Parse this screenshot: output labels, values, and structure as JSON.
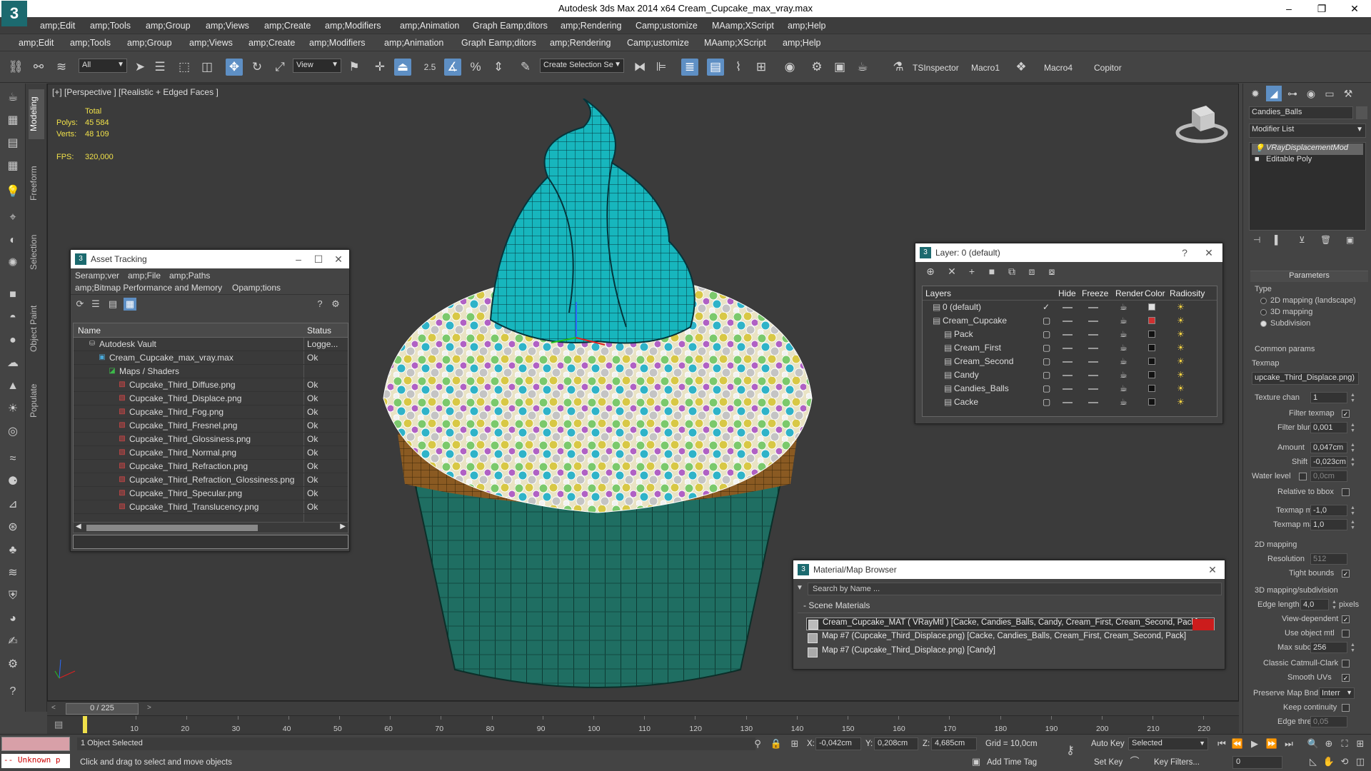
{
  "app": {
    "title": "Autodesk 3ds Max  2014 x64     Cream_Cupcake_max_vray.max"
  },
  "menu_primary": [
    "amp;Edit",
    "amp;Tools",
    "amp;Group",
    "amp;Views",
    "amp;Create",
    "amp;Modifiers",
    "amp;Animation",
    "Graph Eamp;ditors",
    "amp;Rendering",
    "Camp;ustomize",
    "MAamp;XScript",
    "amp;Help"
  ],
  "menu_secondary": [
    "amp;Edit",
    "amp;Tools",
    "amp;Group",
    "amp;Views",
    "amp;Create",
    "amp;Modifiers",
    "amp;Animation",
    "Graph Eamp;ditors",
    "amp;Rendering",
    "Camp;ustomize",
    "MAamp;XScript",
    "amp;Help"
  ],
  "toolbar": {
    "filter_value": "All",
    "refcoord_value": "View",
    "snap_angle": "2.5",
    "selection_set_placeholder": "Create Selection Se",
    "scripts": [
      "TSInspector",
      "Macro1",
      "Macro4",
      "Copitor"
    ]
  },
  "ribbon_tabs": [
    "Modeling",
    "Freeform",
    "Selection",
    "Object Paint",
    "Populate"
  ],
  "viewport": {
    "label": "[+] [Perspective ] [Realistic + Edged Faces ]",
    "stats": {
      "total_label": "Total",
      "polys_label": "Polys:",
      "polys_value": "45 584",
      "verts_label": "Verts:",
      "verts_value": "48 109",
      "fps_label": "FPS:",
      "fps_value": "320,000"
    },
    "colors": {
      "frosting": "#17b6bd",
      "cake": "#8a5a22",
      "wrapper": "#1f6e62"
    }
  },
  "asset_tracking": {
    "title": "Asset Tracking",
    "menus": [
      "Seramp;ver",
      "amp;File",
      "amp;Paths",
      "amp;Bitmap Performance and Memory",
      "Opamp;tions"
    ],
    "columns": {
      "name": "Name",
      "status": "Status"
    },
    "rows": [
      {
        "name": "Autodesk Vault",
        "status": "Logge...",
        "indent": 1,
        "icon": "vault-icon"
      },
      {
        "name": "Cream_Cupcake_max_vray.max",
        "status": "Ok",
        "indent": 2,
        "icon": "max-file-icon"
      },
      {
        "name": "Maps / Shaders",
        "status": "",
        "indent": 3,
        "icon": "maps-icon"
      },
      {
        "name": "Cupcake_Third_Diffuse.png",
        "status": "Ok",
        "indent": 4,
        "icon": "image-icon"
      },
      {
        "name": "Cupcake_Third_Displace.png",
        "status": "Ok",
        "indent": 4,
        "icon": "image-icon"
      },
      {
        "name": "Cupcake_Third_Fog.png",
        "status": "Ok",
        "indent": 4,
        "icon": "image-icon"
      },
      {
        "name": "Cupcake_Third_Fresnel.png",
        "status": "Ok",
        "indent": 4,
        "icon": "image-icon"
      },
      {
        "name": "Cupcake_Third_Glossiness.png",
        "status": "Ok",
        "indent": 4,
        "icon": "image-icon"
      },
      {
        "name": "Cupcake_Third_Normal.png",
        "status": "Ok",
        "indent": 4,
        "icon": "image-icon"
      },
      {
        "name": "Cupcake_Third_Refraction.png",
        "status": "Ok",
        "indent": 4,
        "icon": "image-icon"
      },
      {
        "name": "Cupcake_Third_Refraction_Glossiness.png",
        "status": "Ok",
        "indent": 4,
        "icon": "image-icon"
      },
      {
        "name": "Cupcake_Third_Specular.png",
        "status": "Ok",
        "indent": 4,
        "icon": "image-icon"
      },
      {
        "name": "Cupcake_Third_Translucency.png",
        "status": "Ok",
        "indent": 4,
        "icon": "image-icon"
      }
    ]
  },
  "layer_window": {
    "title": "Layer: 0 (default)",
    "help": "?",
    "columns": [
      "Layers",
      "Hide",
      "Freeze",
      "Render",
      "Color",
      "Radiosity"
    ],
    "rows": [
      {
        "name": "0 (default)",
        "indent": 1,
        "current": true,
        "color": "#e0e0e0"
      },
      {
        "name": "Cream_Cupcake",
        "indent": 1,
        "current": false,
        "color": "#d03030"
      },
      {
        "name": "Pack",
        "indent": 2,
        "current": false,
        "color": "#111111"
      },
      {
        "name": "Cream_First",
        "indent": 2,
        "current": false,
        "color": "#111111"
      },
      {
        "name": "Cream_Second",
        "indent": 2,
        "current": false,
        "color": "#111111"
      },
      {
        "name": "Candy",
        "indent": 2,
        "current": false,
        "color": "#111111"
      },
      {
        "name": "Candies_Balls",
        "indent": 2,
        "current": false,
        "color": "#111111"
      },
      {
        "name": "Cacke",
        "indent": 2,
        "current": false,
        "color": "#111111"
      }
    ]
  },
  "material_browser": {
    "title": "Material/Map Browser",
    "search_placeholder": "Search by Name ...",
    "section": "- Scene Materials",
    "items": [
      "Cream_Cupcake_MAT  ( VRayMtl ) [Cacke, Candies_Balls, Candy, Cream_First, Cream_Second, Pack]",
      "Map #7 (Cupcake_Third_Displace.png) [Cacke, Candies_Balls, Cream_First, Cream_Second, Pack]",
      "Map #7 (Cupcake_Third_Displace.png) [Candy]"
    ]
  },
  "command_panel": {
    "object_name": "Candies_Balls",
    "modifier_list": "Modifier List",
    "stack": [
      "VRayDisplacementMod",
      "Editable Poly"
    ],
    "rollout_title": "Parameters",
    "type_label": "Type",
    "type_options": [
      "2D mapping (landscape)",
      "3D mapping",
      "Subdivision"
    ],
    "type_selected": 2,
    "common_params": "Common params",
    "texmap_label": "Texmap",
    "texmap_value": "upcake_Third_Displace.png)",
    "texture_chan_label": "Texture chan",
    "texture_chan_value": "1",
    "filter_texmap_label": "Filter texmap",
    "filter_blur_label": "Filter blur",
    "filter_blur_value": "0,001",
    "amount_label": "Amount",
    "amount_value": "0,047cm",
    "shift_label": "Shift",
    "shift_value": "-0,023cm",
    "water_level_label": "Water level",
    "water_level_value": "0,0cm",
    "relative_bbox_label": "Relative to bbox",
    "texmap_min_label": "Texmap min",
    "texmap_min_value": "-1,0",
    "texmap_max_label": "Texmap max",
    "texmap_max_value": "1,0",
    "mapping2d_label": "2D mapping",
    "resolution_label": "Resolution",
    "resolution_value": "512",
    "tight_bounds_label": "Tight bounds",
    "mapping3d_label": "3D mapping/subdivision",
    "edge_length_label": "Edge length",
    "edge_length_value": "4,0",
    "pixels_label": "pixels",
    "view_dependent_label": "View-dependent",
    "use_object_mtl_label": "Use object mtl",
    "max_subdivs_label": "Max subdivs",
    "max_subdivs_value": "256",
    "classic_cc_label": "Classic Catmull-Clark",
    "smooth_uvs_label": "Smooth UVs",
    "preserve_map_label": "Preserve Map Bnd",
    "preserve_map_value": "Interr",
    "keep_continuity_label": "Keep continuity",
    "edge_thresh_label": "Edge thresh",
    "edge_thresh_value": "0,05"
  },
  "timeline": {
    "slider_text": "0 / 225",
    "ticks": [
      10,
      20,
      30,
      40,
      50,
      60,
      70,
      80,
      90,
      100,
      110,
      120,
      130,
      140,
      150,
      160,
      170,
      180,
      190,
      200,
      210,
      220
    ]
  },
  "status": {
    "maxscript": "-- Unknown p",
    "selected": "1 Object Selected",
    "prompt": "Click and drag to select and move objects",
    "x_label": "X:",
    "x_value": "-0,042cm",
    "y_label": "Y:",
    "y_value": "0,208cm",
    "z_label": "Z:",
    "z_value": "4,685cm",
    "grid": "Grid = 10,0cm",
    "add_time_tag": "Add Time Tag",
    "auto_key": "Auto Key",
    "selected_dropdown": "Selected",
    "set_key": "Set Key",
    "key_filters": "Key Filters...",
    "frame_value": "0"
  }
}
